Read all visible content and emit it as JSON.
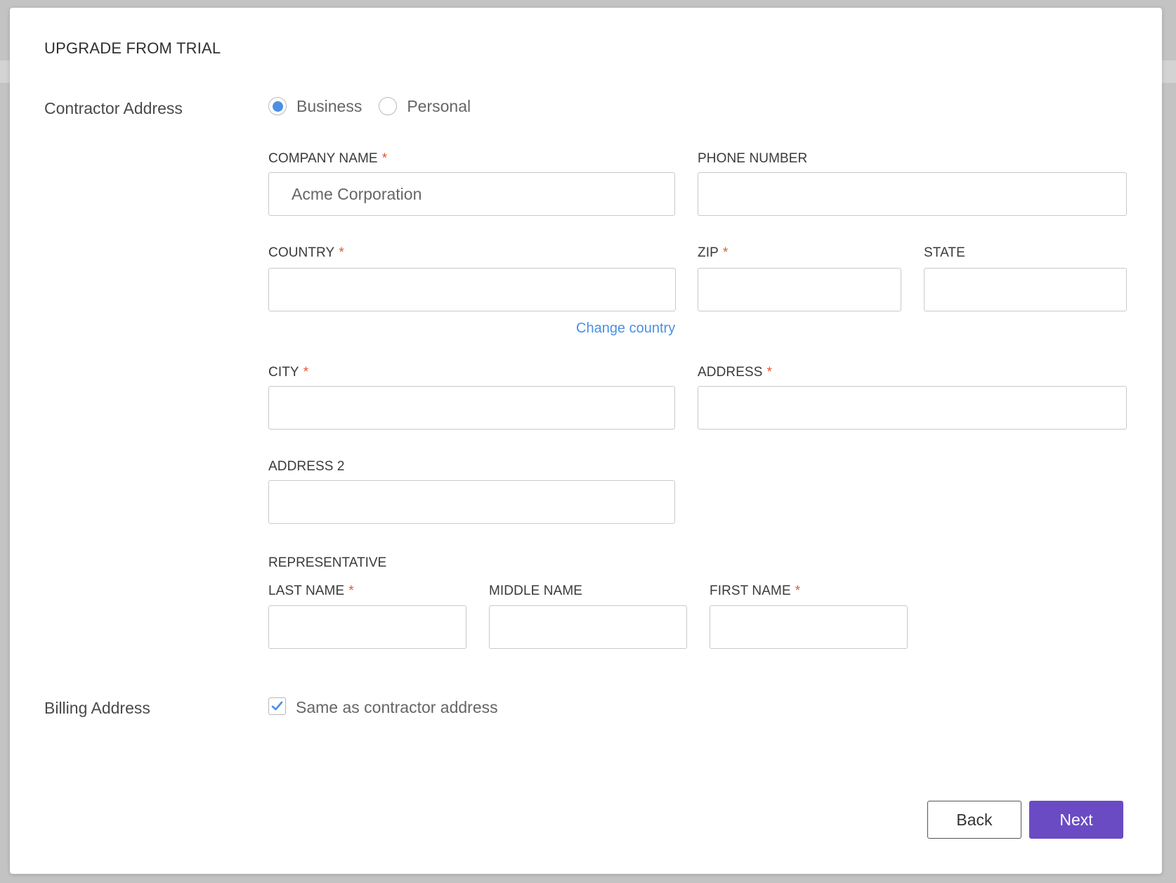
{
  "dialog": {
    "title": "UPGRADE FROM TRIAL"
  },
  "contractor_address": {
    "label": "Contractor Address",
    "type_options": [
      {
        "label": "Business",
        "selected": true
      },
      {
        "label": "Personal",
        "selected": false
      }
    ]
  },
  "fields": {
    "company_name": {
      "label": "COMPANY NAME",
      "required": "*",
      "value": "Acme Corporation"
    },
    "phone_number": {
      "label": "PHONE NUMBER",
      "value": ""
    },
    "country": {
      "label": "COUNTRY",
      "required": "*",
      "value": ""
    },
    "change_country_link": "Change country",
    "zip": {
      "label": "ZIP",
      "required": "*",
      "value": ""
    },
    "state": {
      "label": "STATE",
      "value": ""
    },
    "city": {
      "label": "CITY",
      "required": "*",
      "value": ""
    },
    "address": {
      "label": "ADDRESS",
      "required": "*",
      "value": ""
    },
    "address2": {
      "label": "ADDRESS 2",
      "value": ""
    }
  },
  "representative": {
    "heading": "REPRESENTATIVE",
    "last_name": {
      "label": "LAST NAME",
      "required": "*",
      "value": ""
    },
    "middle_name": {
      "label": "MIDDLE NAME",
      "value": ""
    },
    "first_name": {
      "label": "FIRST NAME",
      "required": "*",
      "value": ""
    }
  },
  "billing_address": {
    "label": "Billing Address",
    "same_as_contractor": {
      "label": "Same as contractor address",
      "checked": true
    }
  },
  "footer": {
    "back_label": "Back",
    "next_label": "Next"
  },
  "colors": {
    "accent": "#4a90e2",
    "primary_button": "#6a4bc3",
    "required_marker": "#e4572e"
  }
}
